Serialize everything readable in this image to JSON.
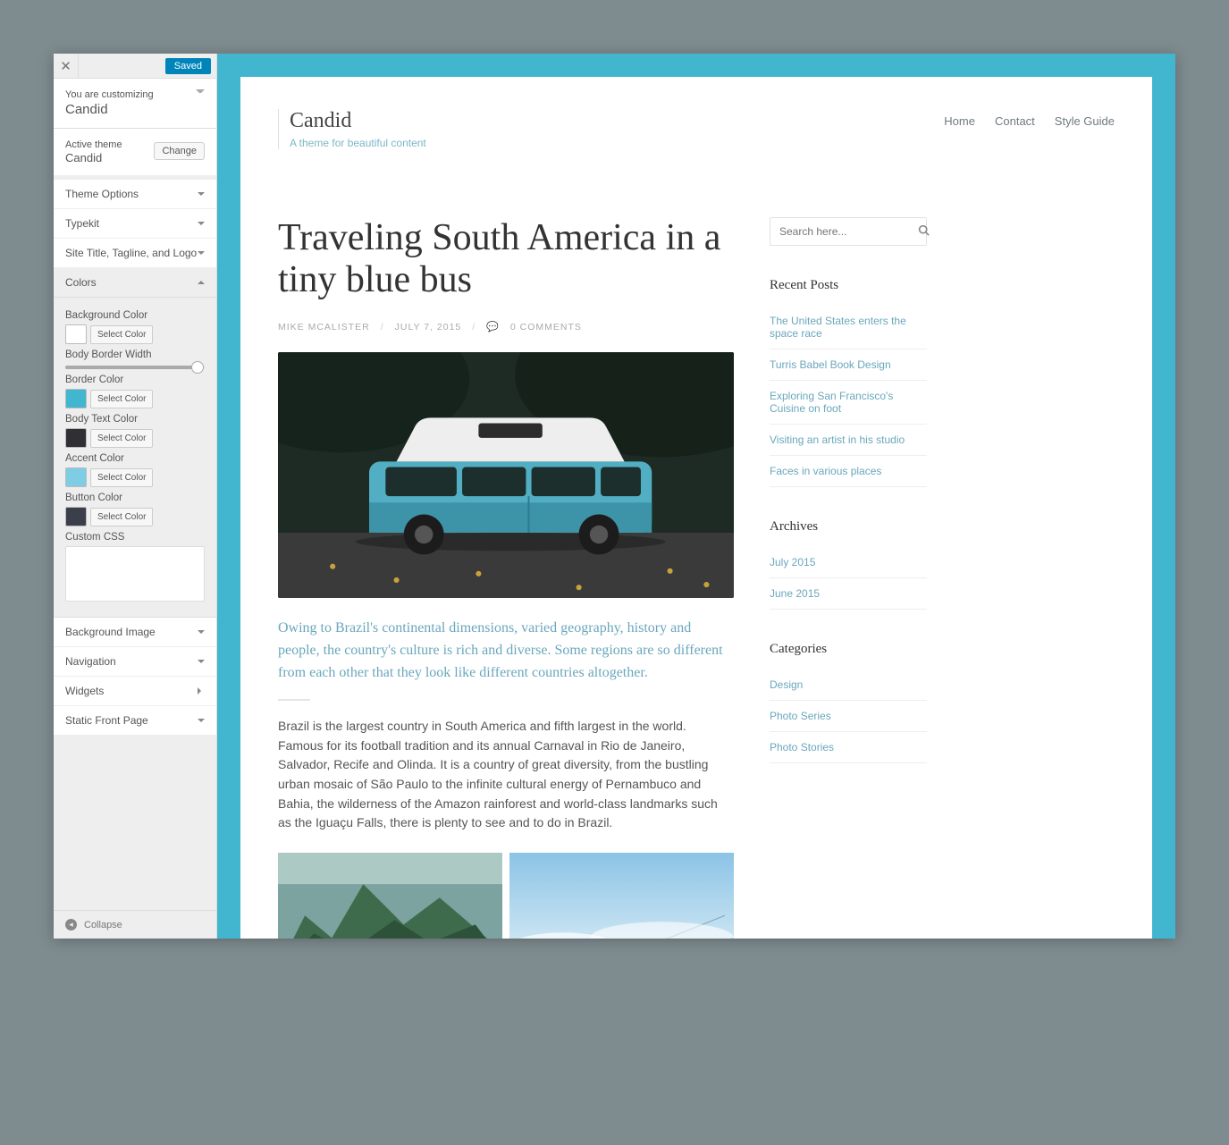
{
  "sidebar": {
    "status_label": "Saved",
    "customizing_label": "You are customizing",
    "theme_name": "Candid",
    "active_theme_label": "Active theme",
    "active_theme_name": "Candid",
    "change_label": "Change",
    "sections": {
      "theme_options": "Theme Options",
      "typekit": "Typekit",
      "site_title": "Site Title, Tagline, and Logo",
      "colors": "Colors",
      "background_image": "Background Image",
      "navigation": "Navigation",
      "widgets": "Widgets",
      "static_front": "Static Front Page"
    },
    "colors": {
      "bg_label": "Background Color",
      "bg_value": "#ffffff",
      "border_width_label": "Body Border Width",
      "border_width_value": 95,
      "border_color_label": "Border Color",
      "border_color_value": "#42b6cf",
      "body_text_label": "Body Text Color",
      "body_text_value": "#2f2f34",
      "accent_label": "Accent Color",
      "accent_value": "#7ecde4",
      "button_label": "Button Color",
      "button_value": "#3b3f4c",
      "select_label": "Select Color",
      "custom_css_label": "Custom CSS"
    },
    "collapse_label": "Collapse"
  },
  "site": {
    "title": "Candid",
    "tagline": "A theme for beautiful content",
    "nav": [
      "Home",
      "Contact",
      "Style Guide"
    ]
  },
  "post": {
    "title": "Traveling South America in a tiny blue bus",
    "author": "MIKE MCALISTER",
    "date": "JULY 7, 2015",
    "comments_label": "0 COMMENTS",
    "lede": "Owing to Brazil's continental dimensions, varied geography, history and people, the country's culture is rich and diverse. Some regions are so different from each other that they look like different countries altogether.",
    "body": "Brazil is the largest country in South America and fifth largest in the world. Famous for its football tradition and its annual Carnaval in Rio de Janeiro, Salvador, Recife and Olinda. It is a country of great diversity, from the bustling urban mosaic of São Paulo to the infinite cultural energy of Pernambuco and Bahia, the wilderness of the Amazon rainforest and world-class landmarks such as the Iguaçu Falls, there is plenty to see and to do in Brazil."
  },
  "widgets": {
    "search_placeholder": "Search here...",
    "recent_title": "Recent Posts",
    "recent": [
      "The United States enters the space race",
      "Turris Babel Book Design",
      "Exploring San Francisco's Cuisine on foot",
      "Visiting an artist in his studio",
      "Faces in various places"
    ],
    "archives_title": "Archives",
    "archives": [
      "July 2015",
      "June 2015"
    ],
    "categories_title": "Categories",
    "categories": [
      "Design",
      "Photo Series",
      "Photo Stories"
    ]
  }
}
